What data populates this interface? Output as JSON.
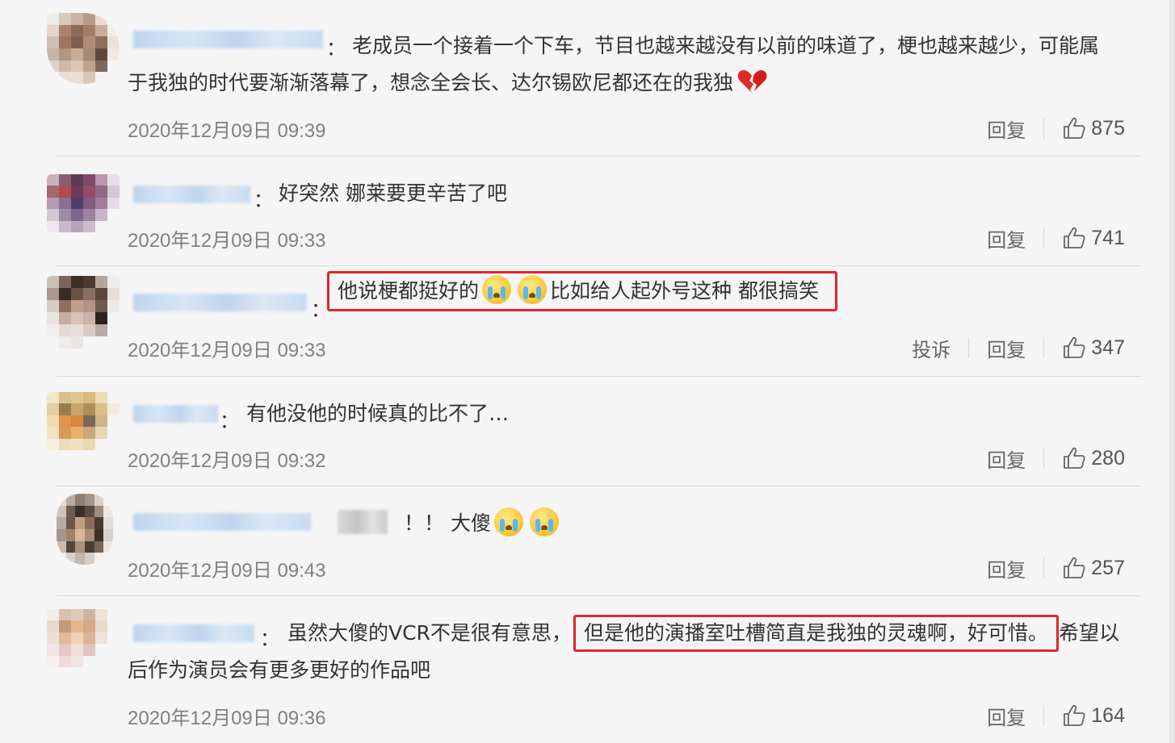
{
  "comments": [
    {
      "text_line1": "老成员一个接着一个下车，节目也越来越没有以前的味道了，梗也越来越少，可能属",
      "text_line2": "于我独的时代要渐渐落幕了，想念全会长、达尔锡欧尼都还在的我独",
      "time": "2020年12月09日 09:39",
      "reply": "回复",
      "likes": "875"
    },
    {
      "text": "好突然 娜莱要更辛苦了吧",
      "time": "2020年12月09日 09:33",
      "reply": "回复",
      "likes": "741"
    },
    {
      "text_a": "他说梗都挺好的",
      "text_b": "比如给人起外号这种 都很搞笑",
      "time": "2020年12月09日 09:33",
      "report": "投诉",
      "reply": "回复",
      "likes": "347"
    },
    {
      "text": "有他没他的时候真的比不了…",
      "time": "2020年12月09日 09:32",
      "reply": "回复",
      "likes": "280"
    },
    {
      "text": "！！ 大傻",
      "time": "2020年12月09日 09:43",
      "reply": "回复",
      "likes": "257"
    },
    {
      "text_pre": "虽然大傻的VCR不是很有意思，",
      "text_highlight": "但是他的演播室吐槽简直是我独的灵魂啊，好可惜。",
      "text_post": "希望以",
      "text_line2": "后作为演员会有更多更好的作品吧",
      "time": "2020年12月09日 09:36",
      "reply": "回复",
      "likes": "164"
    }
  ],
  "colon": "：",
  "icons": {
    "like": "thumbs-up-icon",
    "crying": "crying-face-icon",
    "broken_heart": "broken-heart-icon"
  },
  "colors": {
    "highlight_border": "#e0252e",
    "time": "#808080",
    "name_blur": "#bcd4ef"
  }
}
